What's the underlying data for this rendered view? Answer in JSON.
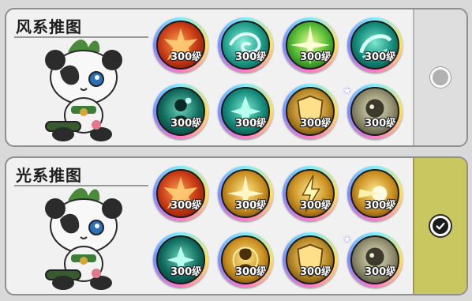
{
  "groups": [
    {
      "title": "风系推图",
      "selected": false,
      "skills": [
        {
          "icon": "fire-burst-icon",
          "level": "300级"
        },
        {
          "icon": "wind-vortex-icon",
          "level": "300级"
        },
        {
          "icon": "green-blast-icon",
          "level": "300级"
        },
        {
          "icon": "wind-swirl-icon",
          "level": "300级"
        },
        {
          "icon": "wind-figure-icon",
          "level": "300级"
        },
        {
          "icon": "wind-dash-icon",
          "level": "300级"
        },
        {
          "icon": "gold-shield-icon",
          "level": "300级"
        },
        {
          "icon": "pet-portrait-icon",
          "level": "300级"
        }
      ]
    },
    {
      "title": "光系推图",
      "selected": true,
      "skills": [
        {
          "icon": "fire-burst-icon",
          "level": "300级"
        },
        {
          "icon": "light-star-icon",
          "level": "300级"
        },
        {
          "icon": "light-lightning-icon",
          "level": "300级"
        },
        {
          "icon": "light-flash-icon",
          "level": "300级"
        },
        {
          "icon": "wind-dash-icon",
          "level": "300级"
        },
        {
          "icon": "light-figure-icon",
          "level": "300级"
        },
        {
          "icon": "gold-shield-icon",
          "level": "300级"
        },
        {
          "icon": "pet-portrait-icon",
          "level": "300级"
        }
      ]
    }
  ]
}
